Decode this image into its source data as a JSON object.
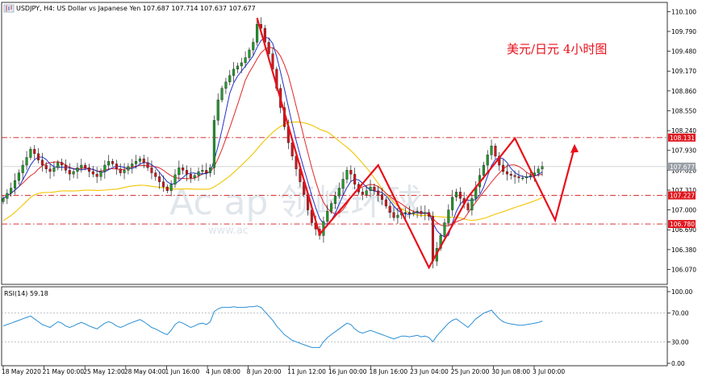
{
  "header": {
    "symbol_info": "USDJPY, H4:  US Dollar vs Japanese Yen  107.687 107.714 107.637 107.677"
  },
  "annotation": {
    "text": "美元/日元 4小时图"
  },
  "watermark": {
    "text": "Ac    ap 领峰环球",
    "url": "www.ac"
  },
  "colors": {
    "bull_candle": "#1e9a2a",
    "bear_candle": "#d4141c",
    "ma_fast": "#2030c8",
    "ma_mid": "#e02828",
    "ma_slow": "#f2c400",
    "rsi_line": "#2a8fd4",
    "level_line": "#d01818",
    "annotation": "#e8101a",
    "price_label_red": "#e01820",
    "price_label_gray": "#9aa0a6"
  },
  "chart_data": [
    {
      "type": "candlestick",
      "title": "USDJPY, H4",
      "y_ticks": [
        "110.100",
        "109.790",
        "109.480",
        "109.170",
        "108.860",
        "108.550",
        "108.240",
        "107.930",
        "107.620",
        "107.310",
        "107.000",
        "106.690",
        "106.380",
        "106.070"
      ],
      "ylim": [
        105.9,
        110.18
      ],
      "x_ticks": [
        "18 May 2020",
        "21 May 00:00",
        "25 May 12:00",
        "28 May 04:00",
        "1 Jun 16:00",
        "4 Jun 08:00",
        "8 Jun 20:00",
        "11 Jun 12:00",
        "16 Jun 00:00",
        "18 Jun 16:00",
        "23 Jun 04:00",
        "25 Jun 20:00",
        "30 Jun 08:00",
        "3 Jul 00:00"
      ],
      "levels": [
        {
          "value": 108.131,
          "label": "108.131",
          "style": "dash-dot",
          "label_color": "red"
        },
        {
          "value": 107.227,
          "label": "107.227",
          "style": "dash-dot",
          "label_color": "red"
        },
        {
          "value": 106.78,
          "label": "106.780",
          "style": "dash-dot",
          "label_color": "red"
        }
      ],
      "current_price": {
        "value": 107.677,
        "label": "107.677"
      },
      "closes": [
        107.18,
        107.26,
        107.34,
        107.46,
        107.58,
        107.7,
        107.82,
        107.95,
        107.88,
        107.78,
        107.7,
        107.64,
        107.6,
        107.66,
        107.74,
        107.7,
        107.62,
        107.56,
        107.6,
        107.66,
        107.7,
        107.66,
        107.6,
        107.56,
        107.52,
        107.6,
        107.7,
        107.76,
        107.72,
        107.64,
        107.58,
        107.62,
        107.68,
        107.72,
        107.76,
        107.8,
        107.74,
        107.66,
        107.58,
        107.52,
        107.44,
        107.36,
        107.3,
        107.4,
        107.55,
        107.66,
        107.62,
        107.56,
        107.5,
        107.54,
        107.6,
        107.62,
        107.58,
        107.66,
        108.4,
        108.72,
        108.9,
        109.0,
        109.1,
        109.2,
        109.25,
        109.3,
        109.38,
        109.5,
        109.62,
        109.9,
        109.84,
        109.62,
        109.44,
        109.2,
        108.9,
        108.6,
        108.3,
        108.05,
        107.84,
        107.64,
        107.44,
        107.24,
        107.0,
        106.8,
        106.7,
        106.6,
        106.82,
        106.98,
        107.1,
        107.22,
        107.34,
        107.48,
        107.62,
        107.56,
        107.4,
        107.28,
        107.24,
        107.3,
        107.36,
        107.3,
        107.24,
        107.16,
        107.06,
        106.96,
        106.88,
        106.92,
        106.96,
        106.96,
        106.94,
        106.96,
        106.98,
        106.94,
        106.96,
        106.9,
        106.2,
        106.4,
        106.6,
        106.8,
        107.0,
        107.2,
        107.28,
        107.18,
        107.1,
        107.0,
        107.18,
        107.36,
        107.54,
        107.7,
        107.86,
        108.0,
        107.84,
        107.7,
        107.6,
        107.56,
        107.54,
        107.52,
        107.5,
        107.5,
        107.52,
        107.54,
        107.58,
        107.64,
        107.68
      ]
    },
    {
      "type": "line",
      "title": "RSI(14) 59.18",
      "y_ticks": [
        "100.00",
        "70.00",
        "30.00",
        "0.00"
      ],
      "ylim": [
        0,
        100
      ],
      "levels": [
        70,
        30
      ],
      "values": [
        52,
        54,
        56,
        58,
        60,
        62,
        64,
        66,
        62,
        58,
        54,
        52,
        50,
        54,
        58,
        56,
        52,
        50,
        52,
        55,
        57,
        55,
        52,
        50,
        48,
        52,
        56,
        58,
        56,
        52,
        50,
        52,
        55,
        57,
        59,
        61,
        58,
        54,
        50,
        48,
        45,
        42,
        40,
        46,
        54,
        58,
        56,
        53,
        50,
        52,
        55,
        56,
        54,
        58,
        72,
        76,
        78,
        78,
        78,
        79,
        78,
        78,
        78,
        79,
        79,
        80,
        78,
        72,
        66,
        60,
        52,
        46,
        40,
        36,
        32,
        30,
        28,
        26,
        24,
        22,
        22,
        22,
        30,
        36,
        40,
        44,
        48,
        52,
        56,
        54,
        48,
        44,
        42,
        44,
        46,
        44,
        42,
        40,
        38,
        36,
        34,
        36,
        38,
        38,
        37,
        38,
        39,
        37,
        38,
        36,
        30,
        38,
        44,
        50,
        56,
        60,
        62,
        58,
        54,
        50,
        56,
        62,
        66,
        70,
        72,
        74,
        68,
        62,
        58,
        56,
        55,
        54,
        53,
        53,
        54,
        55,
        56,
        57,
        59
      ]
    }
  ]
}
